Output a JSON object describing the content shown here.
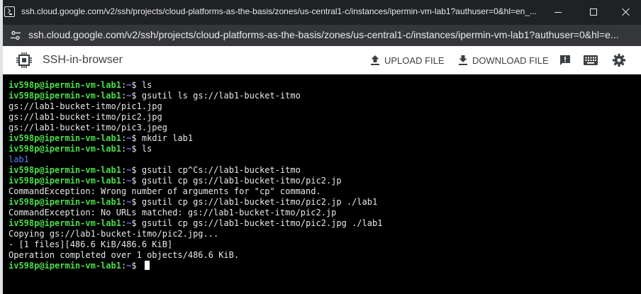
{
  "window": {
    "title": "ssh.cloud.google.com/v2/ssh/projects/cloud-platforms-as-the-basis/zones/us-central1-c/instances/ipermin-vm-lab1?authuser=0&hl=en_..."
  },
  "urlbar": {
    "url": "ssh.cloud.google.com/v2/ssh/projects/cloud-platforms-as-the-basis/zones/us-central1-c/instances/ipermin-vm-lab1?authuser=0&hl=e..."
  },
  "header": {
    "title": "SSH-in-browser",
    "upload_label": "UPLOAD FILE",
    "download_label": "DOWNLOAD FILE",
    "icons": [
      "feedback-icon",
      "keyboard-icon",
      "settings-icon"
    ]
  },
  "colors": {
    "prompt_user": "#4ade4a",
    "prompt_path": "#5b7ff0",
    "terminal_bg": "#000000",
    "header_bg": "#ffffff",
    "titlebar_bg": "#202124"
  },
  "terminal": {
    "prompt_user": "iv598p@ipermin-vm-lab1",
    "prompt_sep": ":",
    "prompt_path": "~",
    "prompt_symbol": "$ ",
    "lines": [
      {
        "type": "prompt",
        "text": "ls"
      },
      {
        "type": "prompt",
        "text": "gsutil ls gs://lab1-bucket-itmo"
      },
      {
        "type": "output",
        "text": "gs://lab1-bucket-itmo/pic1.jpg"
      },
      {
        "type": "output",
        "text": "gs://lab1-bucket-itmo/pic2.jpg"
      },
      {
        "type": "output",
        "text": "gs://lab1-bucket-itmo/pic3.jpeg"
      },
      {
        "type": "prompt",
        "text": "mkdir lab1"
      },
      {
        "type": "prompt",
        "text": "ls"
      },
      {
        "type": "dir",
        "text": "lab1"
      },
      {
        "type": "prompt",
        "text": "gsutil cp^Cs://lab1-bucket-itmo"
      },
      {
        "type": "prompt",
        "text": "gsutil cp gs://lab1-bucket-itmo/pic2.jp"
      },
      {
        "type": "output",
        "text": "CommandException: Wrong number of arguments for \"cp\" command."
      },
      {
        "type": "prompt",
        "text": "gsutil cp gs://lab1-bucket-itmo/pic2.jp ./lab1"
      },
      {
        "type": "output",
        "text": "CommandException: No URLs matched: gs://lab1-bucket-itmo/pic2.jp"
      },
      {
        "type": "prompt",
        "text": "gsutil cp gs://lab1-bucket-itmo/pic2.jpg ./lab1"
      },
      {
        "type": "output",
        "text": "Copying gs://lab1-bucket-itmo/pic2.jpg..."
      },
      {
        "type": "output",
        "text": "- [1 files][486.6 KiB/486.6 KiB]"
      },
      {
        "type": "output",
        "text": "Operation completed over 1 objects/486.6 KiB."
      },
      {
        "type": "prompt_cursor",
        "text": ""
      }
    ]
  }
}
